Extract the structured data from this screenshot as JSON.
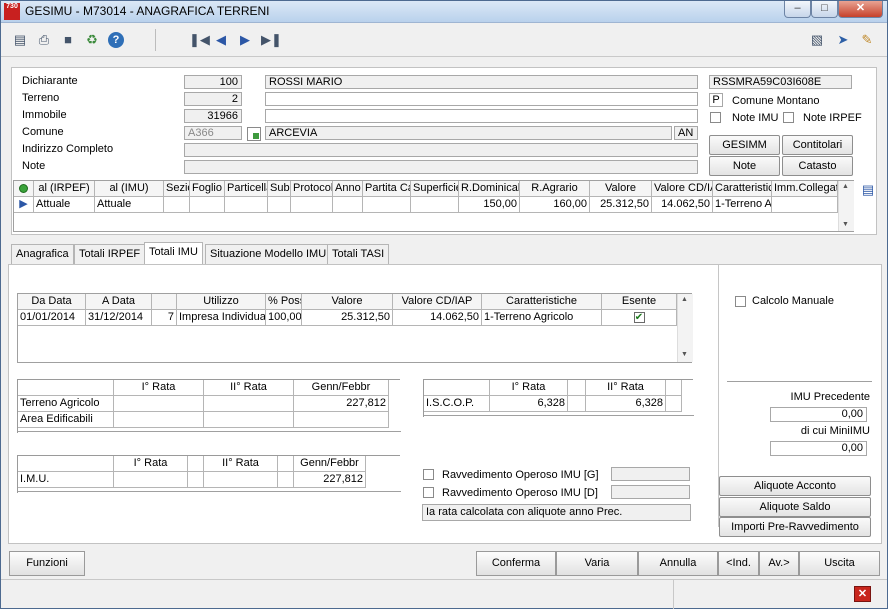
{
  "window": {
    "app_icon_text": "730",
    "title": "GESIMU  - M73014 -  ANAGRAFICA TERRENI"
  },
  "header": {
    "dichiarante_label": "Dichiarante",
    "dichiarante_code": "100",
    "dichiarante_name": "ROSSI MARIO",
    "terreno_label": "Terreno",
    "terreno_value": "2",
    "immobile_label": "Immobile",
    "immobile_value": "31966",
    "comune_label": "Comune",
    "comune_code": "A366",
    "comune_name": "ARCEVIA",
    "comune_prov": "AN",
    "indirizzo_label": "Indirizzo Completo",
    "note_label": "Note",
    "codice_fiscale": "RSSMRA59C03I608E",
    "comune_montano_flag": "P",
    "comune_montano_label": "Comune Montano",
    "note_imu_label": "Note IMU",
    "note_irpef_label": "Note IRPEF",
    "btn_gesimm": "GESIMM",
    "btn_contitolari": "Contitolari",
    "btn_note": "Note",
    "btn_catasto": "Catasto"
  },
  "top_grid": {
    "headers": [
      "al (IRPEF)",
      "al (IMU)",
      "Sezio",
      "Foglio",
      "Particella",
      "Sub",
      "Protocoll",
      "Anno",
      "Partita Ca",
      "Superficie",
      "R.Dominicale",
      "R.Agrario",
      "Valore",
      "Valore CD/IA",
      "Caratteristic",
      "Imm.Collegato"
    ],
    "row": [
      "Attuale",
      "Attuale",
      "",
      "",
      "",
      "",
      "",
      "",
      "",
      "",
      "150,00",
      "160,00",
      "25.312,50",
      "14.062,50",
      "1-Terreno A",
      ""
    ]
  },
  "tabs": [
    "Anagrafica",
    "Totali IRPEF",
    "Totali IMU",
    "Situazione Modello IMU",
    "Totali TASI"
  ],
  "imu_grid": {
    "headers": [
      "Da Data",
      "A Data",
      "",
      "Utilizzo",
      "% Poss",
      "Valore",
      "Valore CD/IAP",
      "Caratteristiche",
      "Esente"
    ],
    "row": [
      "01/01/2014",
      "31/12/2014",
      "7",
      "Impresa Individua",
      "100,00",
      "25.312,50",
      "14.062,50",
      "1-Terreno Agricolo",
      "✔"
    ]
  },
  "rate_table": {
    "headers": [
      "I° Rata",
      "II° Rata",
      "Genn/Febbr"
    ],
    "rows": [
      {
        "label": "Terreno Agricolo",
        "values": [
          "",
          "",
          "227,812"
        ]
      },
      {
        "label": "Area Edificabili",
        "values": [
          "",
          "",
          ""
        ]
      }
    ]
  },
  "iscop_table": {
    "headers": [
      "I° Rata",
      "II° Rata"
    ],
    "label": "I.S.C.O.P.",
    "values": [
      "6,328",
      "6,328"
    ]
  },
  "imu_table": {
    "headers": [
      "I° Rata",
      "II° Rata",
      "Genn/Febbr"
    ],
    "label": "I.M.U.",
    "values": [
      "",
      "",
      "227,812"
    ]
  },
  "ravvedimento": {
    "g_label": "Ravvedimento Operoso IMU [G]",
    "d_label": "Ravvedimento Operoso IMU [D]",
    "note": "Ia rata calcolata con aliquote anno Prec."
  },
  "side": {
    "calcolo_manuale": "Calcolo Manuale",
    "imu_precedente_label": "IMU Precedente",
    "imu_precedente_value": "0,00",
    "minimu_label": "di cui MiniIMU",
    "minimu_value": "0,00",
    "btn_acconto": "Aliquote Acconto",
    "btn_saldo": "Aliquote Saldo",
    "btn_importi": "Importi Pre-Ravvedimento"
  },
  "bottom": {
    "funzioni": "Funzioni",
    "conferma": "Conferma",
    "varia": "Varia",
    "annulla": "Annulla",
    "ind": "<Ind.",
    "av": "Av.>",
    "uscita": "Uscita"
  }
}
